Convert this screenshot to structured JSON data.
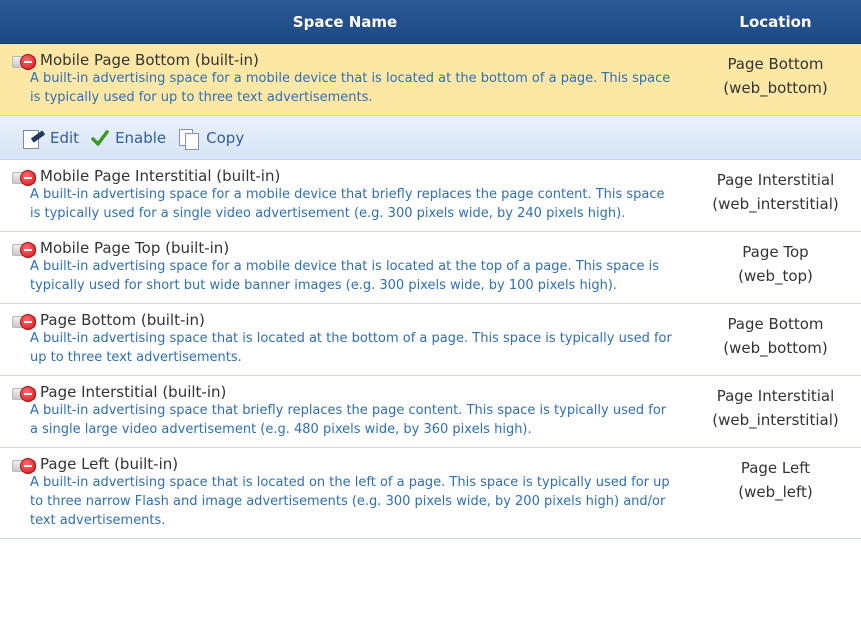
{
  "header": {
    "space_name": "Space Name",
    "location": "Location"
  },
  "actions": {
    "edit": "Edit",
    "enable": "Enable",
    "copy": "Copy"
  },
  "rows": [
    {
      "title": "Mobile Page Bottom (built-in)",
      "desc": "A built-in advertising space for a mobile device that is located at the bottom of a page. This space is typically used for up to three text advertisements.",
      "loc1": "Page Bottom",
      "loc2": "(web_bottom)"
    },
    {
      "title": "Mobile Page Interstitial (built-in)",
      "desc": "A built-in advertising space for a mobile device that briefly replaces the page content. This space is typically used for a single video advertisement (e.g. 300 pixels wide, by 240 pixels high).",
      "loc1": "Page Interstitial",
      "loc2": "(web_interstitial)"
    },
    {
      "title": "Mobile Page Top (built-in)",
      "desc": "A built-in advertising space for a mobile device that is located at the top of a page. This space is typically used for short but wide banner images (e.g. 300 pixels wide, by 100 pixels high).",
      "loc1": "Page Top",
      "loc2": "(web_top)"
    },
    {
      "title": "Page Bottom (built-in)",
      "desc": "A built-in advertising space that is located at the bottom of a page. This space is typically used for up to three text advertisements.",
      "loc1": "Page Bottom",
      "loc2": "(web_bottom)"
    },
    {
      "title": "Page Interstitial (built-in)",
      "desc": "A built-in advertising space that briefly replaces the page content. This space is typically used for a single large video advertisement (e.g. 480 pixels wide, by 360 pixels high).",
      "loc1": "Page Interstitial",
      "loc2": "(web_interstitial)"
    },
    {
      "title": "Page Left (built-in)",
      "desc": "A built-in advertising space that is located on the left of a page. This space is typically used for up to three narrow Flash and image advertisements (e.g. 300 pixels wide, by 200 pixels high) and/or text advertisements.",
      "loc1": "Page Left",
      "loc2": "(web_left)"
    }
  ],
  "colors": {
    "header_bg": "#245090",
    "selected_row_bg": "#fde7a5",
    "description_text": "#2e6fb6",
    "action_text": "#2e5f9f"
  },
  "icons": {
    "row_status": "disabled-icon",
    "edit": "edit-icon",
    "enable": "checkmark-icon",
    "copy": "copy-icon"
  }
}
